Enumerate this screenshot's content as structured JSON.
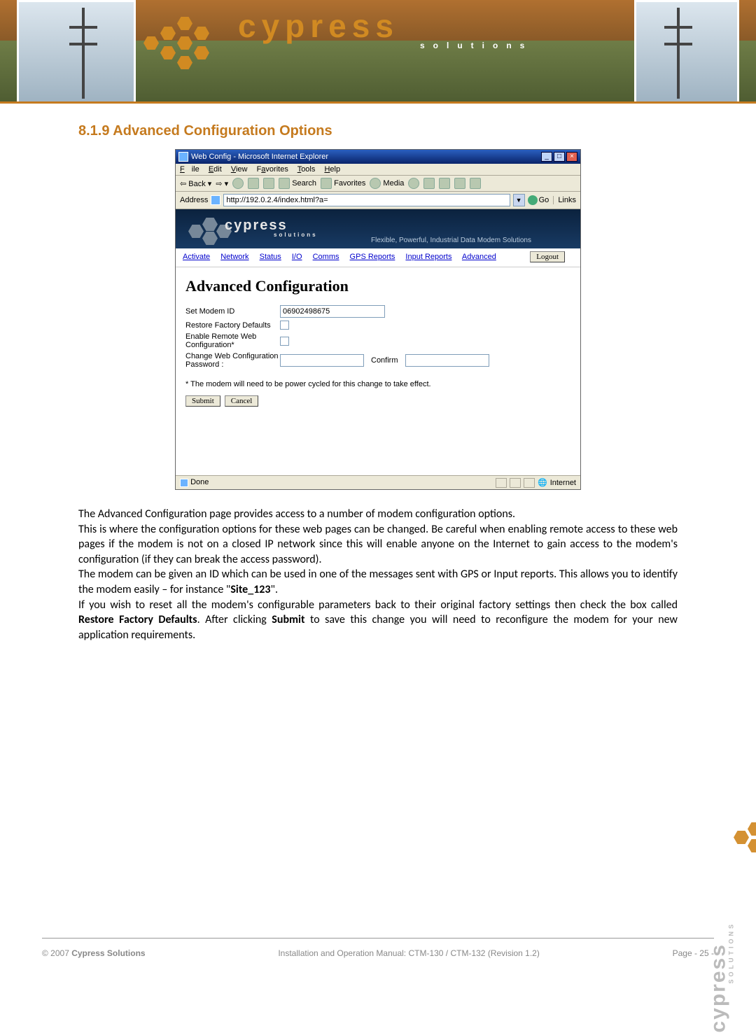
{
  "section_heading": "8.1.9  Advanced Configuration Options",
  "ie": {
    "title": "Web Config - Microsoft Internet Explorer",
    "menu": {
      "file": "File",
      "edit": "Edit",
      "view": "View",
      "fav": "Favorites",
      "tools": "Tools",
      "help": "Help"
    },
    "toolbar": {
      "back": "Back",
      "search": "Search",
      "favorites": "Favorites",
      "media": "Media"
    },
    "addr_label": "Address",
    "addr_value": "http://192.0.2.4/index.html?a=",
    "go": "Go",
    "links": "Links",
    "status_done": "Done",
    "status_zone": "Internet"
  },
  "page": {
    "brand": "cypress",
    "brand_sub": "SOLUTIONS",
    "tagline": "Flexible, Powerful, Industrial Data Modem Solutions",
    "nav": {
      "activate": "Activate",
      "network": "Network",
      "status": "Status",
      "io": "I/O",
      "comms": "Comms",
      "gps": "GPS Reports",
      "input": "Input Reports",
      "advanced": "Advanced"
    },
    "logout": "Logout",
    "h2": "Advanced Configuration",
    "rows": {
      "modem_id_label": "Set Modem ID",
      "modem_id_value": "06902498675",
      "restore_label": "Restore Factory Defaults",
      "remote_label": "Enable Remote Web Configuration*",
      "pwd_label": "Change Web Configuration Password :",
      "confirm": "Confirm"
    },
    "note": "* The modem will need to be power cycled for this change to take effect.",
    "submit": "Submit",
    "cancel": "Cancel"
  },
  "body": {
    "p1": "The Advanced Configuration page provides access to a number of modem configuration options.",
    "p2a": "This is where the configuration options for these web pages can be changed. Be careful when enabling remote access to these web pages if the modem is not on a closed IP network since this will enable anyone on the Internet to gain access to the modem's configuration (if they can break the access password).",
    "p3a": "The modem can be given an ID which can be used in one of the messages sent with GPS or Input reports. This allows you to identify the modem easily – for instance \"",
    "p3b": "Site_123",
    "p3c": "\".",
    "p4a": "If you wish to reset all the modem's configurable parameters back to their original factory settings then check the box called ",
    "p4b": "Restore Factory Defaults",
    "p4c": ". After clicking ",
    "p4d": "Submit",
    "p4e": " to save this change you will need to reconfigure the modem for your new application requirements."
  },
  "footer": {
    "copyright": "© 2007 ",
    "company": "Cypress Solutions",
    "center": "Installation and Operation Manual: CTM-130 / CTM-132 (Revision 1.2)",
    "page": "Page  - 25 -"
  }
}
